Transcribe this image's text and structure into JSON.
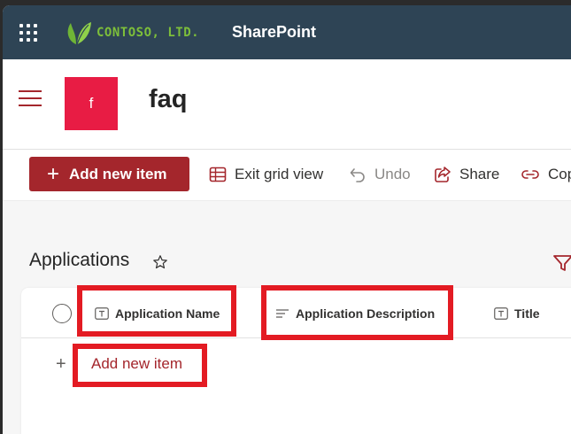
{
  "suite_bar": {
    "brand": "CONTOSO, LTD.",
    "app_name": "SharePoint",
    "colors": {
      "background": "#2e4455",
      "brand": "#7dbf3a"
    }
  },
  "site": {
    "tile_letter": "f",
    "title": "faq",
    "colors": {
      "tile": "#e81c44",
      "theme": "#a4262c"
    }
  },
  "command_bar": {
    "add_new_item": "Add new item",
    "exit_grid_view": "Exit grid view",
    "undo": "Undo",
    "share": "Share",
    "copy_link": "Copy link"
  },
  "list": {
    "title": "Applications",
    "columns": [
      {
        "label": "Application Name",
        "icon": "text-field-icon"
      },
      {
        "label": "Application Description",
        "icon": "multiline-text-icon"
      },
      {
        "label": "Title",
        "icon": "text-field-icon"
      }
    ],
    "add_row_label": "Add new item"
  },
  "annotation_color": "#e31b23"
}
